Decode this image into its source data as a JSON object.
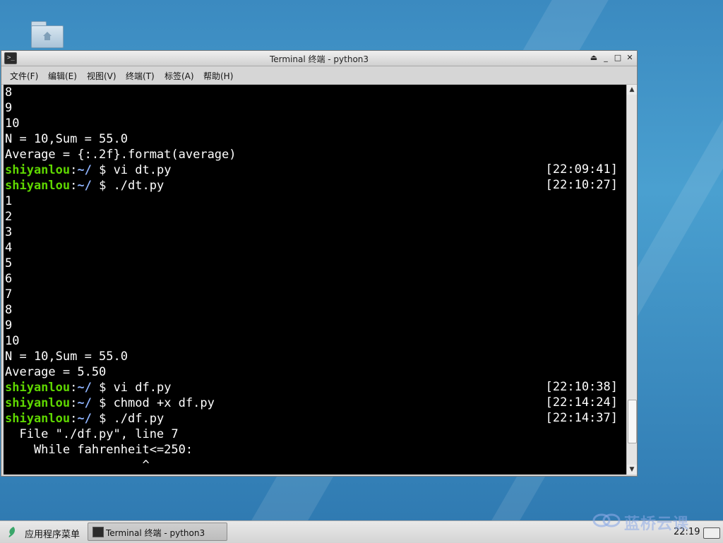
{
  "window": {
    "title": "Terminal 终端 - python3",
    "buttons": [
      "⏏",
      "_",
      "□",
      "✕"
    ]
  },
  "menu": [
    "文件(F)",
    "编辑(E)",
    "视图(V)",
    "终端(T)",
    "标签(A)",
    "帮助(H)"
  ],
  "terminal": {
    "lines": [
      {
        "text": "8"
      },
      {
        "text": "9"
      },
      {
        "text": "10"
      },
      {
        "text": "N = 10,Sum = 55.0"
      },
      {
        "text": "Average = {:.2f}.format(average)"
      },
      {
        "prompt": true,
        "user": "shiyanlou",
        "sep": ":",
        "path": "~/",
        "cmd": " $ vi dt.py",
        "ts": "[22:09:41]"
      },
      {
        "prompt": true,
        "user": "shiyanlou",
        "sep": ":",
        "path": "~/",
        "cmd": " $ ./dt.py",
        "ts": "[22:10:27]"
      },
      {
        "text": "1"
      },
      {
        "text": "2"
      },
      {
        "text": "3"
      },
      {
        "text": "4"
      },
      {
        "text": "5"
      },
      {
        "text": "6"
      },
      {
        "text": "7"
      },
      {
        "text": "8"
      },
      {
        "text": "9"
      },
      {
        "text": "10"
      },
      {
        "text": "N = 10,Sum = 55.0"
      },
      {
        "text": "Average = 5.50"
      },
      {
        "prompt": true,
        "user": "shiyanlou",
        "sep": ":",
        "path": "~/",
        "cmd": " $ vi df.py",
        "ts": "[22:10:38]"
      },
      {
        "prompt": true,
        "user": "shiyanlou",
        "sep": ":",
        "path": "~/",
        "cmd": " $ chmod +x df.py",
        "ts": "[22:14:24]"
      },
      {
        "prompt": true,
        "user": "shiyanlou",
        "sep": ":",
        "path": "~/",
        "cmd": " $ ./df.py",
        "ts": "[22:14:37]"
      },
      {
        "text": "  File \"./df.py\", line 7"
      },
      {
        "text": "    While fahrenheit<=250:"
      },
      {
        "text": "                   ^"
      }
    ],
    "scroll_position": 0.93
  },
  "taskbar": {
    "start_label": "应用程序菜单",
    "task_label": "Terminal 终端 - python3",
    "watermark": "蓝桥云课",
    "clock": "22:19"
  },
  "colors": {
    "prompt_user": "#5fd700",
    "prompt_path": "#8fb4ff",
    "terminal_bg": "#000000"
  }
}
